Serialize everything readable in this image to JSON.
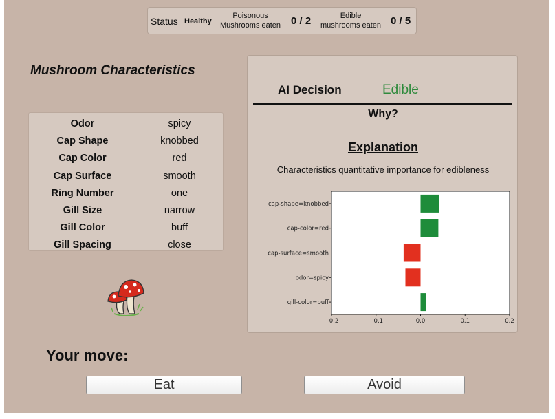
{
  "status_bar": {
    "status_label": "Status",
    "status_value": "Healthy",
    "poisonous_label_1": "Poisonous",
    "poisonous_label_2": "Mushrooms eaten",
    "poisonous_count": "0 / 2",
    "edible_label_1": "Edible",
    "edible_label_2": "mushrooms eaten",
    "edible_count": "0 / 5",
    "colors": {
      "poisonous": "#e83a2a",
      "edible": "#26a83a"
    }
  },
  "characteristics": {
    "title": "Mushroom Characteristics",
    "rows": [
      {
        "key": "Odor",
        "value": "spicy"
      },
      {
        "key": "Cap Shape",
        "value": "knobbed"
      },
      {
        "key": "Cap Color",
        "value": "red"
      },
      {
        "key": "Cap Surface",
        "value": "smooth"
      },
      {
        "key": "Ring Number",
        "value": "one"
      },
      {
        "key": "Gill Size",
        "value": "narrow"
      },
      {
        "key": "Gill Color",
        "value": "buff"
      },
      {
        "key": "Gill Spacing",
        "value": "close"
      }
    ]
  },
  "mushroom_icon": "mushroom-icon",
  "ai": {
    "decision_label": "AI Decision",
    "decision_value": "Edible",
    "why_label": "Why?",
    "explanation_title": "Explanation",
    "explanation_subtitle": "Characteristics quantitative importance for edibleness"
  },
  "chart_data": {
    "type": "bar",
    "orientation": "horizontal",
    "categories": [
      "cap-shape=knobbed",
      "cap-color=red",
      "cap-surface=smooth",
      "odor=spicy",
      "gill-color=buff"
    ],
    "values": [
      0.042,
      0.04,
      -0.038,
      -0.034,
      0.013
    ],
    "xlim": [
      -0.2,
      0.2
    ],
    "xticks": [
      "−0.2",
      "−0.1",
      "0.0",
      "0.1",
      "0.2"
    ],
    "colors": {
      "positive": "#1e8c3a",
      "negative": "#e2301f"
    }
  },
  "bottom": {
    "your_move_label": "Your move:",
    "eat_label": "Eat",
    "avoid_label": "Avoid"
  }
}
